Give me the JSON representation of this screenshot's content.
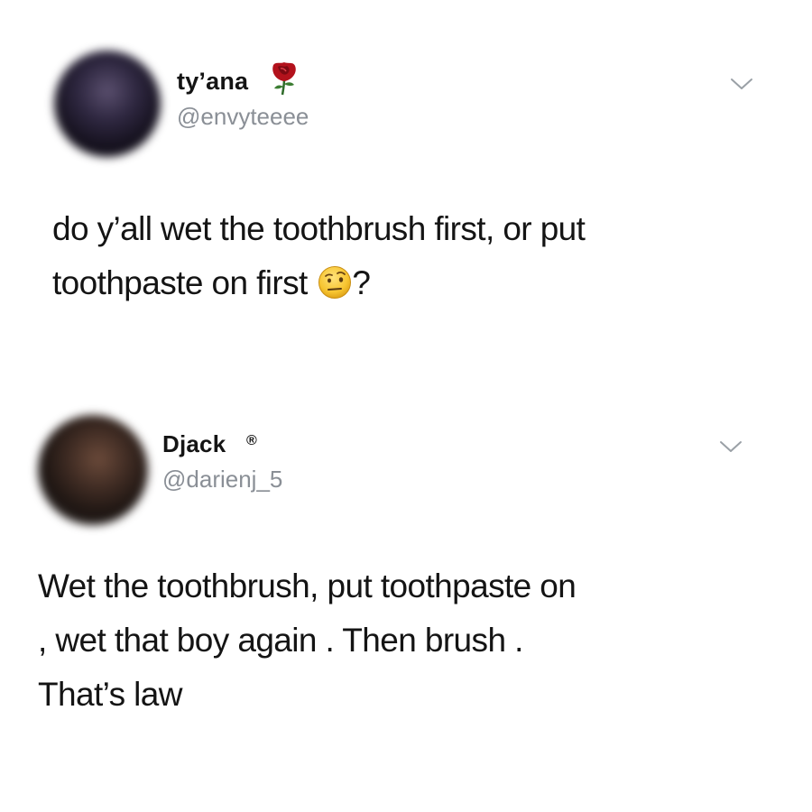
{
  "tweets": [
    {
      "display_name": "ty’ana",
      "handle": "@envyteeee",
      "name_badge_icon": "rose-icon",
      "text_lines": [
        "do y’all wet the toothbrush first, or put",
        "toothpaste on first"
      ],
      "text_end_emoji_icon": "raised-eyebrow-face-icon",
      "text_end": "?"
    },
    {
      "display_name": "Djack",
      "name_badge": "®",
      "handle": "@darienj_5",
      "text_lines": [
        "Wet the toothbrush, put toothpaste on",
        ", wet that boy again . Then brush .",
        "That’s law"
      ]
    }
  ],
  "colors": {
    "text": "#141414",
    "handle": "#8a8f96",
    "chevron": "#9aa0a6",
    "background": "#ffffff"
  }
}
